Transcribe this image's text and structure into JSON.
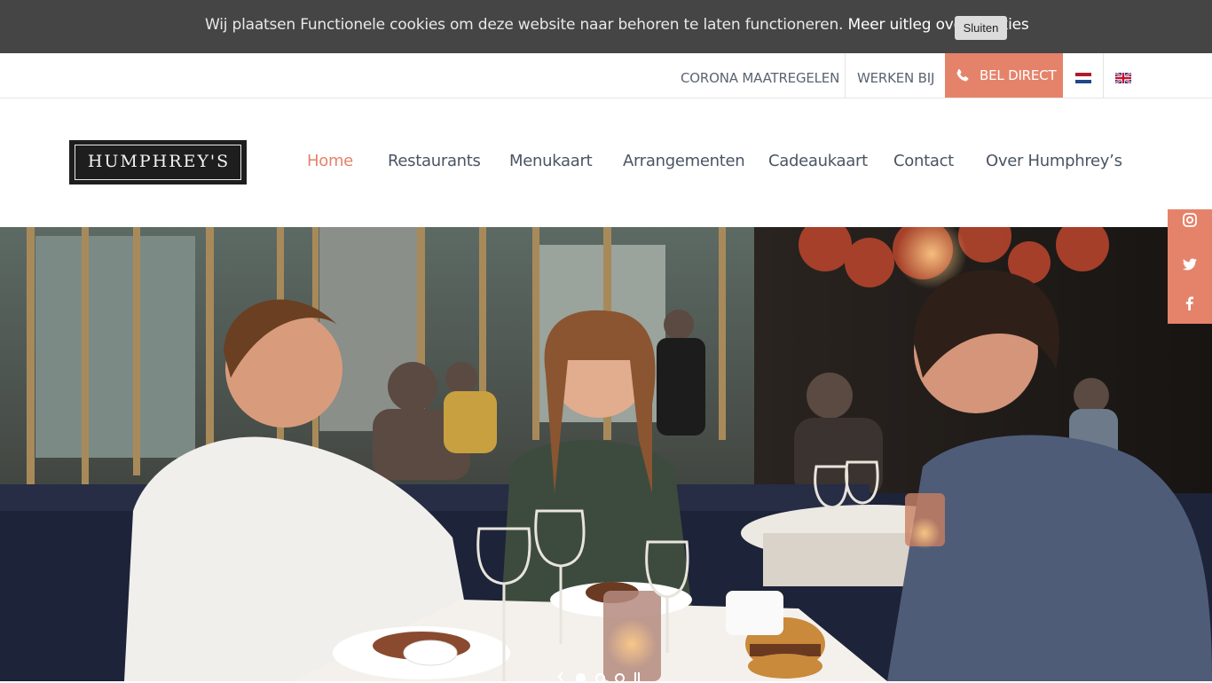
{
  "cookie_bar": {
    "text": "Wij plaatsen Functionele cookies om deze website naar behoren te laten functioneren.",
    "link": "Meer uitleg over cookies",
    "close_label": "Sluiten"
  },
  "topbar": {
    "corona": "CORONA MAATREGELEN",
    "werken": "WERKEN BIJ",
    "bel": "BEL DIRECT",
    "phone_icon": "phone-icon",
    "languages": [
      "nl-flag-icon",
      "en-flag-icon"
    ]
  },
  "header": {
    "logo_text": "HUMPHREY'S",
    "nav": [
      {
        "label": "Home",
        "active": true
      },
      {
        "label": "Restaurants",
        "active": false
      },
      {
        "label": "Menukaart",
        "active": false
      },
      {
        "label": "Arrangementen",
        "active": false
      },
      {
        "label": "Cadeaukaart",
        "active": false
      },
      {
        "label": "Contact",
        "active": false
      },
      {
        "label": "Over Humphrey’s",
        "active": false
      }
    ]
  },
  "social": [
    "instagram-icon",
    "twitter-icon",
    "facebook-icon"
  ],
  "slider": {
    "slide_count": 3,
    "active_slide": 1
  },
  "colors": {
    "accent": "#e5836a",
    "cookie_bg": "#454545",
    "nav_text": "#4a5563"
  }
}
